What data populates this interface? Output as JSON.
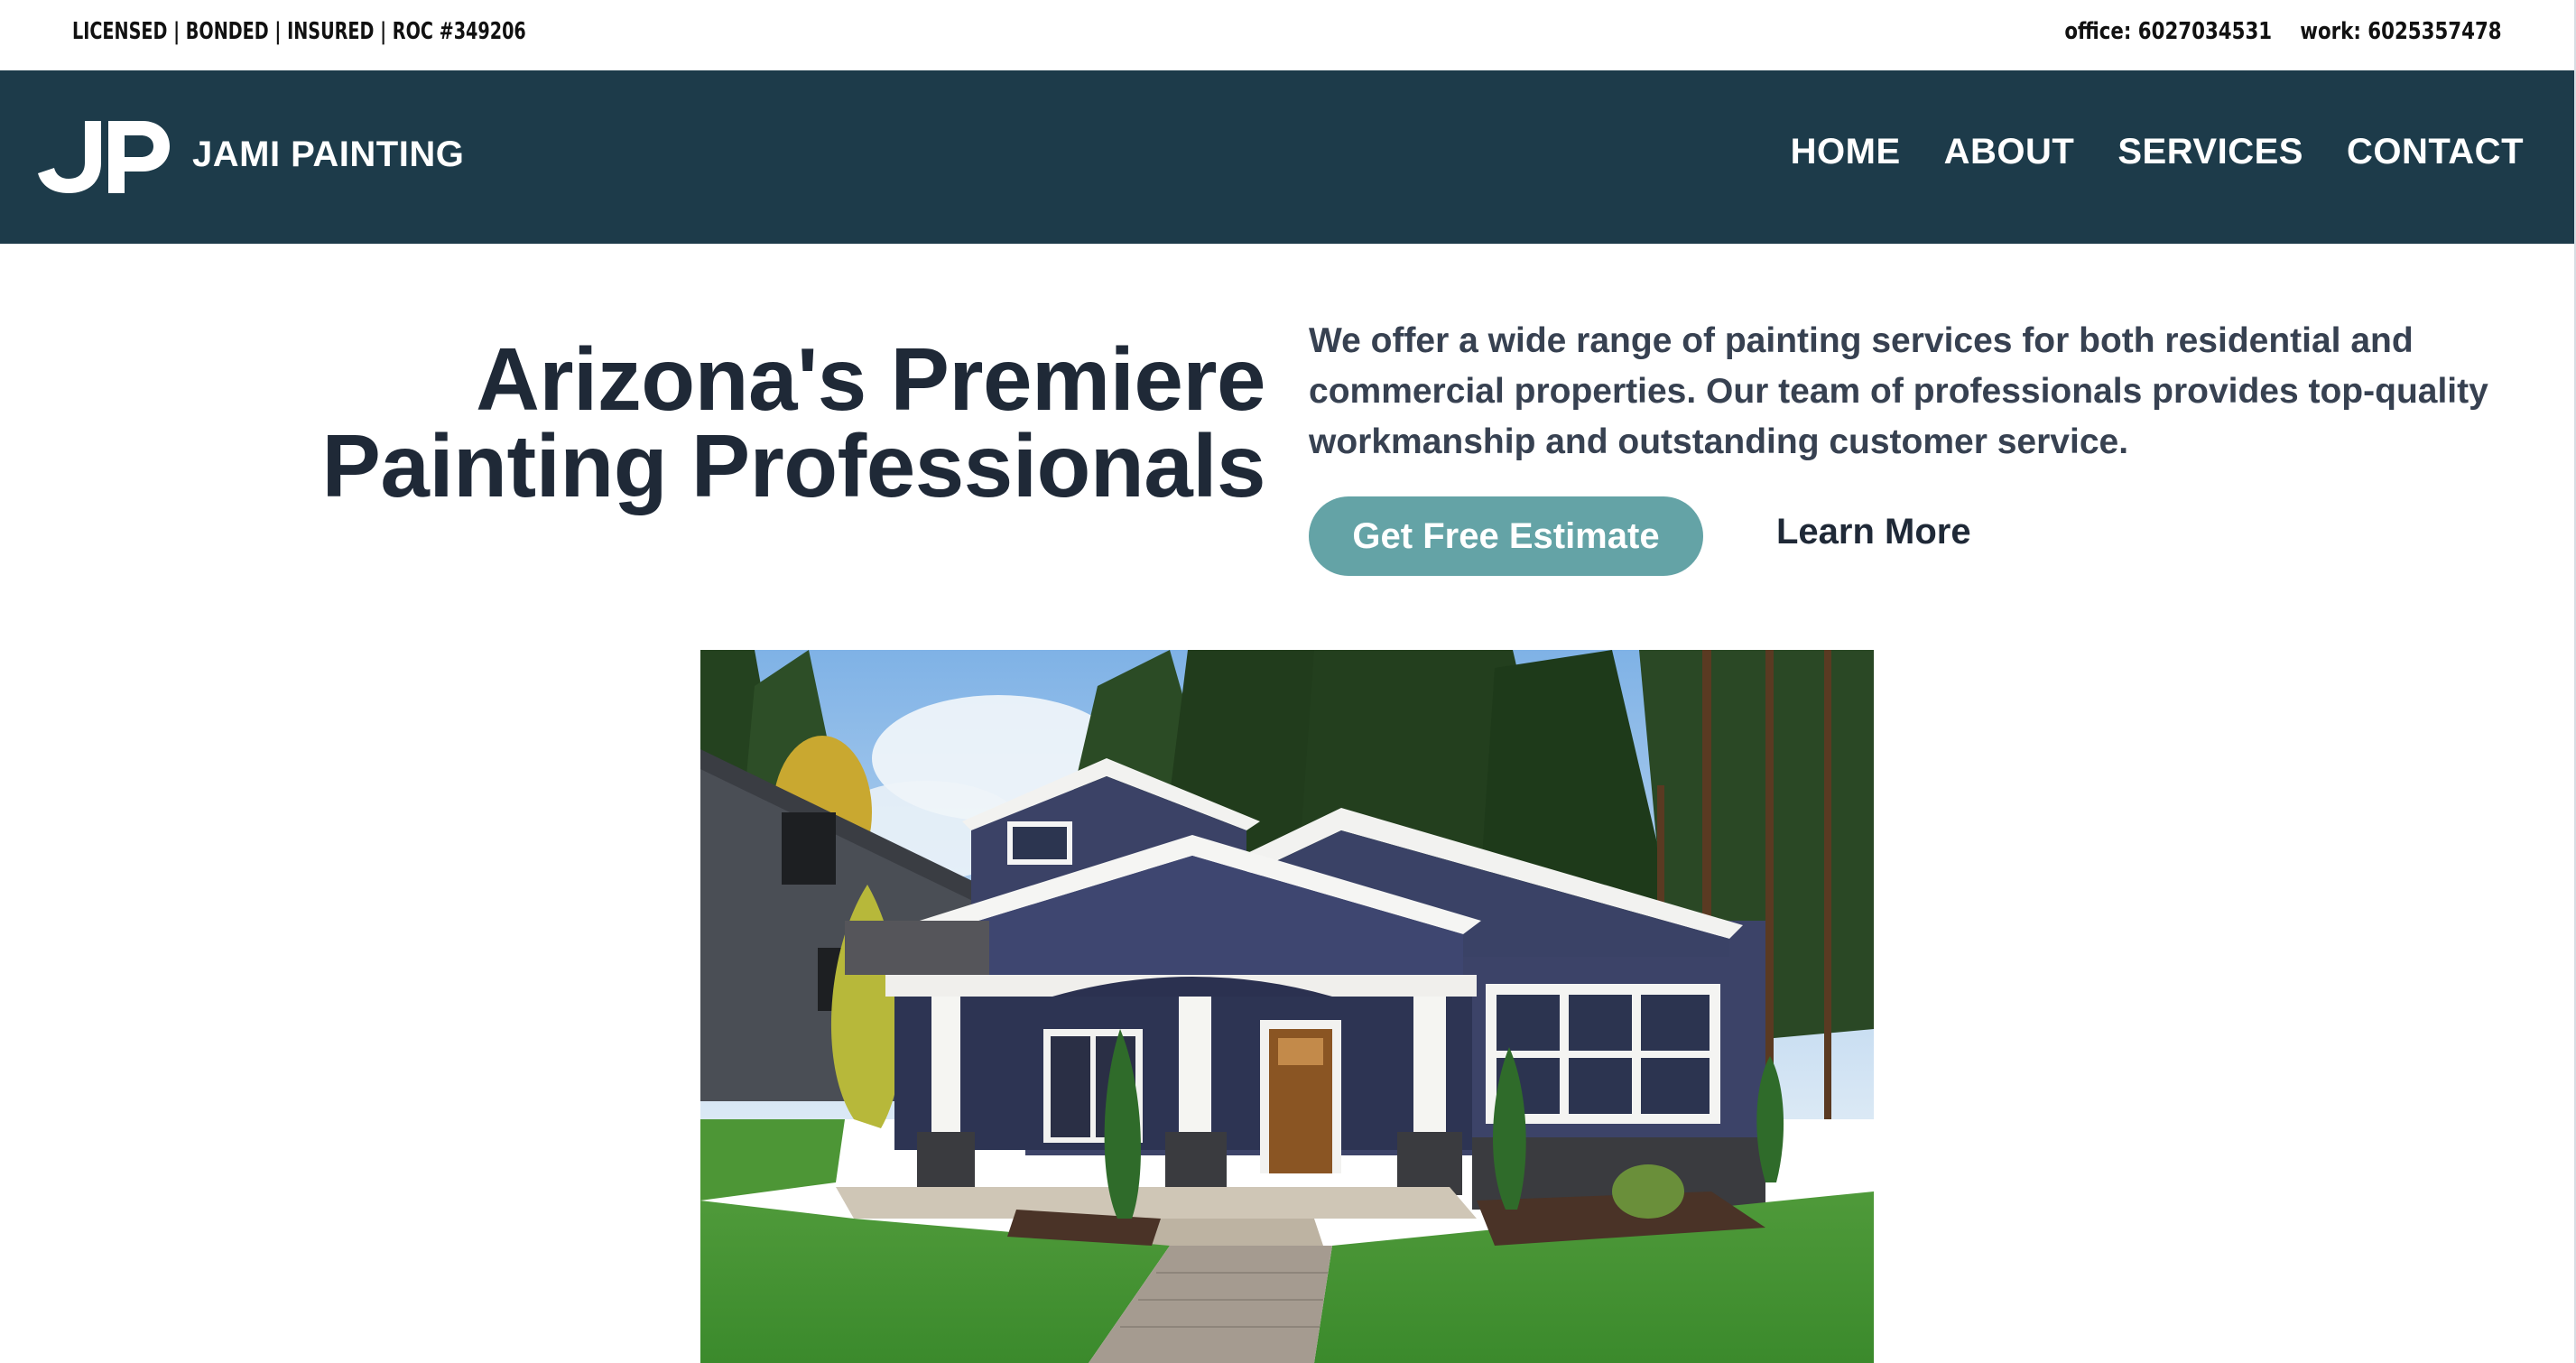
{
  "topbar": {
    "license": "LICENSED | BONDED | INSURED | ROC #349206",
    "office": "office: 6027034531",
    "work": "work: 6025357478"
  },
  "header": {
    "logo_icon": "jp-monogram-icon",
    "brand": "JAMI PAINTING",
    "nav": [
      "HOME",
      "ABOUT",
      "SERVICES",
      "CONTACT"
    ]
  },
  "hero": {
    "title_line1": "Arizona's Premiere",
    "title_line2": "Painting Professionals",
    "description": "We offer a wide range of painting services for both residential and commercial properties. Our team of professionals provides top-quality workmanship and outstanding customer service.",
    "primary_button": "Get Free Estimate",
    "secondary_link": "Learn More"
  },
  "image": {
    "subject": "house-photo"
  },
  "colors": {
    "nav_bg": "#1d3b4a",
    "accent_button": "#64a3a6",
    "heading": "#1f2937",
    "body_text": "#374151"
  }
}
